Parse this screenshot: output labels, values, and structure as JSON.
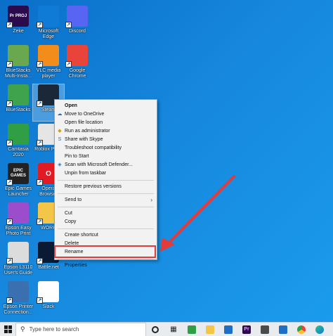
{
  "desktop_icons": [
    {
      "label": "Zeke",
      "icon": "premiere-pro-icon",
      "badge": "Pr PROJ",
      "color": "#2b0b4d"
    },
    {
      "label": "Microsoft Edge",
      "icon": "edge-icon",
      "badge": "",
      "color": "#0f7bd7"
    },
    {
      "label": "Discord",
      "icon": "discord-icon",
      "badge": "",
      "color": "#5865f2"
    },
    {
      "label": "BlueStacks Multi-Insta...",
      "icon": "bluestacks-multi-icon",
      "badge": "",
      "color": "#6aa84f"
    },
    {
      "label": "VLC media player",
      "icon": "vlc-icon",
      "badge": "",
      "color": "#f28c1b"
    },
    {
      "label": "Google Chrome",
      "icon": "chrome-icon",
      "badge": "",
      "color": "#e8443a"
    },
    {
      "label": "BlueStacks",
      "icon": "bluestacks-icon",
      "badge": "",
      "color": "#3fa34d"
    },
    {
      "label": "Steam",
      "icon": "steam-icon",
      "badge": "",
      "color": "#1b2838"
    },
    {
      "label": "Camtasia 2020",
      "icon": "camtasia-icon",
      "badge": "",
      "color": "#2f9e44"
    },
    {
      "label": "Roblox Pla...",
      "icon": "roblox-icon",
      "badge": "",
      "color": "#e5e5e5"
    },
    {
      "label": "Epic Games Launcher",
      "icon": "epic-games-icon",
      "badge": "EPIC GAMES",
      "color": "#222222"
    },
    {
      "label": "Opera Browser",
      "icon": "opera-icon",
      "badge": "O",
      "color": "#e01b24"
    },
    {
      "label": "Epson Easy Photo Print",
      "icon": "epson-photo-icon",
      "badge": "",
      "color": "#9c4dcc"
    },
    {
      "label": "WORK",
      "icon": "folder-icon",
      "badge": "",
      "color": "#f3c64a"
    },
    {
      "label": "Epson L3110 User's Guide",
      "icon": "epson-guide-icon",
      "badge": "",
      "color": "#dcdcdc"
    },
    {
      "label": "Battle.net",
      "icon": "battlenet-icon",
      "badge": "",
      "color": "#0b1a33"
    },
    {
      "label": "Epson Printer Connection...",
      "icon": "epson-printer-icon",
      "badge": "",
      "color": "#3a6fb0"
    },
    {
      "label": "Slack",
      "icon": "slack-icon",
      "badge": "",
      "color": "#ffffff"
    }
  ],
  "context_menu": {
    "items": [
      {
        "label": "Open",
        "bold": true,
        "icon": "",
        "sep_after": false
      },
      {
        "label": "Move to OneDrive",
        "icon": "onedrive-icon",
        "sep_after": false
      },
      {
        "label": "Open file location",
        "icon": "",
        "sep_after": false
      },
      {
        "label": "Run as administrator",
        "icon": "shield-icon",
        "sep_after": false
      },
      {
        "label": "Share with Skype",
        "icon": "skype-icon",
        "sep_after": false
      },
      {
        "label": "Troubleshoot compatibility",
        "icon": "",
        "sep_after": false
      },
      {
        "label": "Pin to Start",
        "icon": "",
        "sep_after": false
      },
      {
        "label": "Scan with Microsoft Defender...",
        "icon": "defender-icon",
        "sep_after": false
      },
      {
        "label": "Unpin from taskbar",
        "icon": "",
        "sep_after": true
      },
      {
        "label": "Restore previous versions",
        "icon": "",
        "sep_after": true
      },
      {
        "label": "Send to",
        "icon": "",
        "submenu": true,
        "sep_after": true
      },
      {
        "label": "Cut",
        "icon": "",
        "sep_after": false
      },
      {
        "label": "Copy",
        "icon": "",
        "sep_after": true
      },
      {
        "label": "Create shortcut",
        "icon": "",
        "sep_after": false
      },
      {
        "label": "Delete",
        "icon": "",
        "sep_after": false
      },
      {
        "label": "Rename",
        "icon": "",
        "sep_after": true
      },
      {
        "label": "Properties",
        "icon": "",
        "sep_after": false
      }
    ],
    "highlighted": "Properties"
  },
  "annotation": {
    "color": "#e23b3b"
  },
  "taskbar": {
    "search_placeholder": "Type here to search",
    "icons": [
      "cortana-icon",
      "task-view-icon",
      "camtasia-taskbar-icon",
      "file-explorer-icon",
      "mail-icon",
      "premiere-taskbar-icon",
      "store-icon",
      "calendar-icon",
      "chrome-taskbar-icon",
      "edge-taskbar-icon"
    ]
  }
}
